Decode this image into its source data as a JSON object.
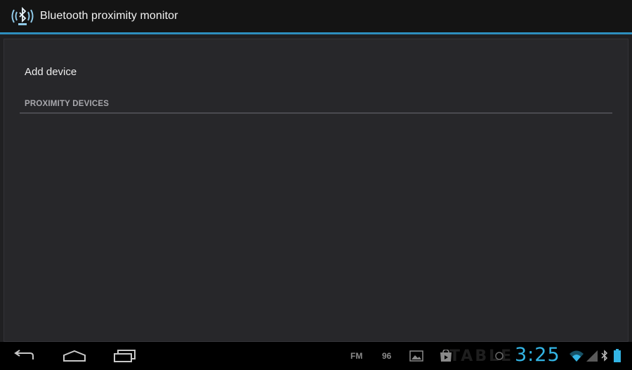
{
  "action_bar": {
    "title": "Bluetooth proximity monitor",
    "icon": "bluetooth-broadcast-icon",
    "accent_color": "#2d8fbf"
  },
  "main": {
    "add_device_label": "Add device",
    "section_header": "PROXIMITY DEVICES",
    "devices": []
  },
  "system_bar": {
    "nav": {
      "back_icon": "back-arrow-icon",
      "home_icon": "home-icon",
      "recent_icon": "recent-apps-icon"
    },
    "status": {
      "fm_label": "FM",
      "number_label": "96",
      "clock": "3:25",
      "clock_color": "#33b5e5",
      "watermark": "TABLE"
    }
  }
}
